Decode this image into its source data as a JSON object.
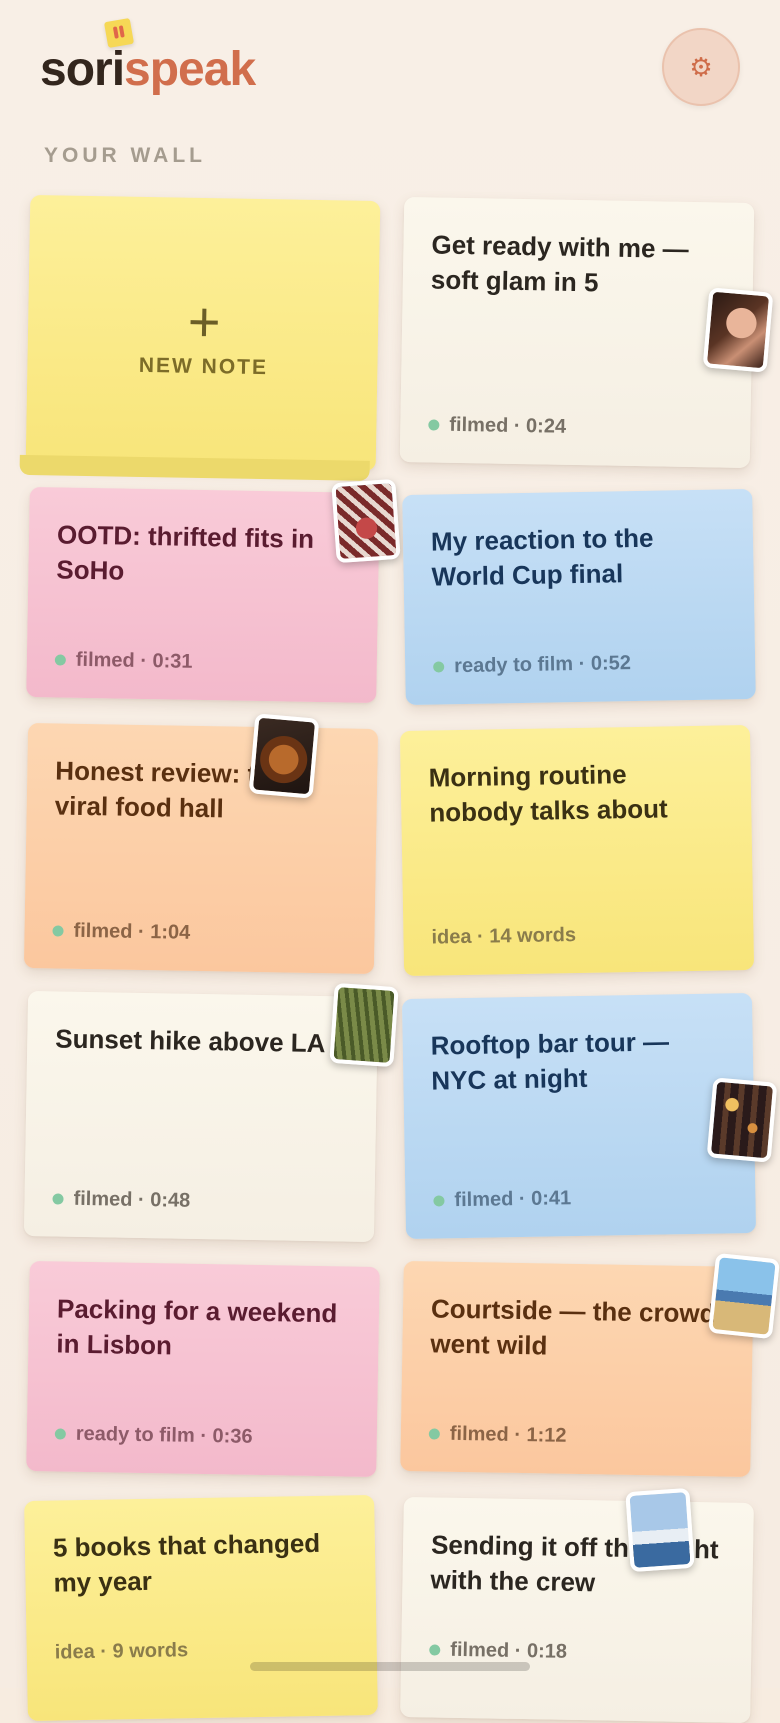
{
  "app": {
    "logo_part1": "sori",
    "logo_part2": "speak",
    "settings_icon": "gear-icon"
  },
  "wall": {
    "title": "YOUR WALL",
    "new_note_label": "NEW NOTE"
  },
  "notes": [
    {
      "title_line1": "Get ready with me —",
      "title_line2": "soft glam in 5",
      "meta": "filmed · 0:24",
      "color": "cream",
      "thumb": "portrait-photo"
    },
    {
      "title_line1": "OOTD: thrifted fits in",
      "title_line2": "SoHo",
      "meta": "filmed · 0:31",
      "color": "pink",
      "thumb": "outfit-photo"
    },
    {
      "title_line1": "My reaction to the",
      "title_line2": "World Cup final",
      "meta": "ready to film · 0:52",
      "color": "blue"
    },
    {
      "title_line1": "Honest review: the",
      "title_line2": "viral food hall",
      "meta": "filmed · 1:04",
      "color": "peach",
      "thumb": "food-photo"
    },
    {
      "title_line1": "Morning routine",
      "title_line2": "nobody talks about",
      "meta": "idea · 14 words",
      "color": "yellow"
    },
    {
      "title_line1": "Sunset hike above LA",
      "title_line2": "",
      "meta": "filmed · 0:48",
      "color": "cream",
      "thumb": "forest-photo"
    },
    {
      "title_line1": "Rooftop bar tour —",
      "title_line2": "NYC at night",
      "meta": "filmed · 0:41",
      "color": "blue",
      "thumb": "bar-photo"
    },
    {
      "title_line1": "Packing for a weekend",
      "title_line2": "in Lisbon",
      "meta": "ready to film · 0:36",
      "color": "pink"
    },
    {
      "title_line1": "Courtside — the crowd",
      "title_line2": "went wild",
      "meta": "filmed · 1:12",
      "color": "peach",
      "thumb": "crowd-photo"
    },
    {
      "title_line1": "5 books that changed",
      "title_line2": "my year",
      "meta": "idea · 9 words",
      "color": "yellow"
    },
    {
      "title_line1": "Sending it off the yacht",
      "title_line2": "with the crew",
      "meta": "filmed · 0:18",
      "color": "cream",
      "thumb": "yacht-photo"
    }
  ],
  "colors": {
    "background": "#f7ece0",
    "accent": "#d16e4c",
    "status_dot": "#84c9a2"
  }
}
